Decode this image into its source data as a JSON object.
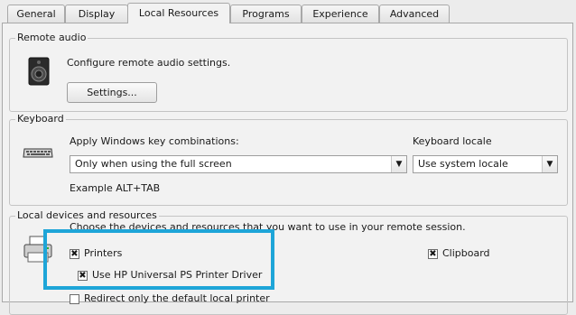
{
  "tabs": [
    {
      "label": "General"
    },
    {
      "label": "Display"
    },
    {
      "label": "Local Resources"
    },
    {
      "label": "Programs"
    },
    {
      "label": "Experience"
    },
    {
      "label": "Advanced"
    }
  ],
  "remote_audio": {
    "title": "Remote audio",
    "description": "Configure remote audio settings.",
    "settings_button": "Settings..."
  },
  "keyboard": {
    "title": "Keyboard",
    "apply_label": "Apply Windows key combinations:",
    "apply_value": "Only when using the full screen",
    "locale_label": "Keyboard locale",
    "locale_value": "Use system locale",
    "example": "Example ALT+TAB"
  },
  "local_devices": {
    "title": "Local devices and resources",
    "description": "Choose the devices and resources that you want to use in your remote session.",
    "printers": {
      "label": "Printers",
      "checked": true
    },
    "hp_driver": {
      "label": "Use HP Universal PS Printer Driver",
      "checked": true
    },
    "default_printer": {
      "label": "Redirect only the default local printer",
      "checked": false
    },
    "clipboard": {
      "label": "Clipboard",
      "checked": true
    }
  },
  "colors": {
    "highlight": "#1ea5d8"
  }
}
